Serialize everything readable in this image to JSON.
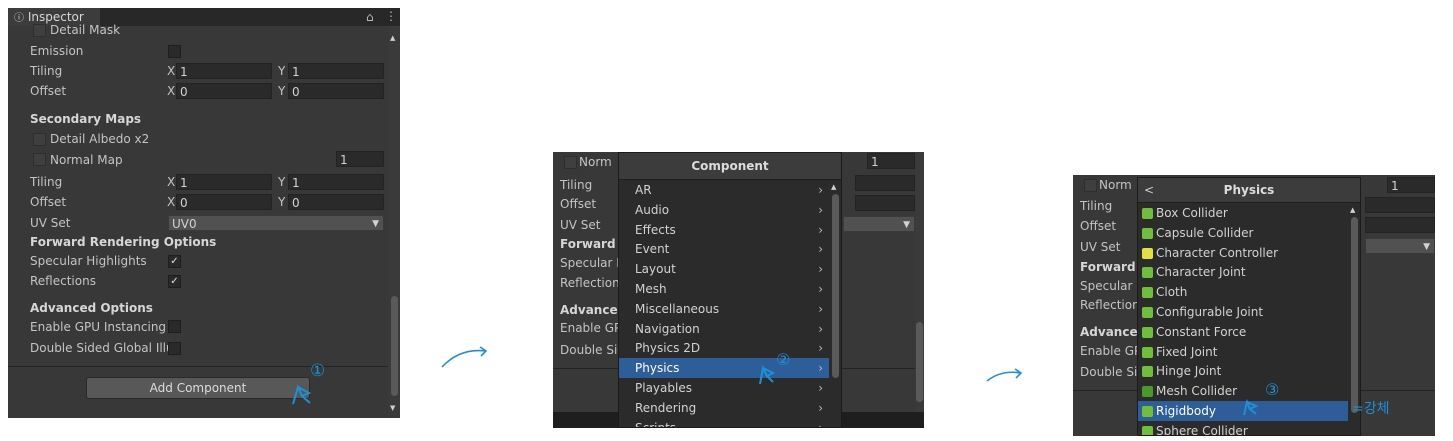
{
  "panel1": {
    "tab_title": "Inspector",
    "rows": {
      "detail_mask": "Detail Mask",
      "emission": "Emission",
      "tiling": "Tiling",
      "tiling_x_label": "X",
      "tiling_x": "1",
      "tiling_y_label": "Y",
      "tiling_y": "1",
      "offset": "Offset",
      "offset_x_label": "X",
      "offset_x": "0",
      "offset_y_label": "Y",
      "offset_y": "0",
      "secondary_maps": "Secondary Maps",
      "detail_albedo": "Detail Albedo x2",
      "normal_map": "Normal Map",
      "normal_map_value": "1",
      "tiling2": "Tiling",
      "tiling2_x_label": "X",
      "tiling2_x": "1",
      "tiling2_y_label": "Y",
      "tiling2_y": "1",
      "offset2": "Offset",
      "offset2_x_label": "X",
      "offset2_x": "0",
      "offset2_y_label": "Y",
      "offset2_y": "0",
      "uv_set": "UV Set",
      "uv_set_value": "UV0",
      "forward_rendering": "Forward Rendering Options",
      "specular_highlights": "Specular Highlights",
      "reflections": "Reflections",
      "advanced_options": "Advanced Options",
      "gpu_instancing": "Enable GPU Instancing",
      "double_sided_gi": "Double Sided Global Illu"
    },
    "add_component_label": "Add Component",
    "step_marker": "①"
  },
  "panel2": {
    "bg_rows": {
      "normal_frag": "Norm",
      "value_1": "1",
      "tiling": "Tiling",
      "offset": "Offset",
      "uv_set": "UV Set",
      "forward": "Forward R",
      "specular": "Specular I",
      "reflections": "Reflection",
      "advanced": "Advanced",
      "gpu": "Enable GP",
      "double": "Double Sid"
    },
    "menu_title": "Component",
    "menu_items": [
      "AR",
      "Audio",
      "Effects",
      "Event",
      "Layout",
      "Mesh",
      "Miscellaneous",
      "Navigation",
      "Physics 2D",
      "Physics",
      "Playables",
      "Rendering",
      "Scripts"
    ],
    "selected_index": 9,
    "step_marker": "②"
  },
  "panel3": {
    "bg_rows": {
      "normal_frag": "Norm",
      "value_1": "1",
      "tiling": "Tiling",
      "offset": "Offset",
      "uv_set": "UV Set",
      "forward": "Forward F",
      "specular": "Specular I",
      "reflections": "Reflection",
      "advanced": "Advanced",
      "gpu": "Enable GP",
      "double": "Double Si"
    },
    "menu_title": "Physics",
    "back_glyph": "<",
    "menu_items": [
      "Box Collider",
      "Capsule Collider",
      "Character Controller",
      "Character Joint",
      "Cloth",
      "Configurable Joint",
      "Constant Force",
      "Fixed Joint",
      "Hinge Joint",
      "Mesh Collider",
      "Rigidbody",
      "Sphere Collider"
    ],
    "icon_colors": [
      "#6fbf3a",
      "#6fbf3a",
      "#e0e040",
      "#6fbf3a",
      "#6fbf3a",
      "#6fbf3a",
      "#6fbf3a",
      "#6fbf3a",
      "#6fbf3a",
      "#4a9a2a",
      "#6fbf3a",
      "#6fbf3a"
    ],
    "selected_index": 10,
    "step_marker": "③",
    "side_note": "=강체"
  },
  "colors": {
    "panel_bg": "#383838",
    "field_bg": "#2a2a2a",
    "menu_bg": "#2b2b2b",
    "selection": "#2e5e9a",
    "annotation": "#1e90d6"
  }
}
